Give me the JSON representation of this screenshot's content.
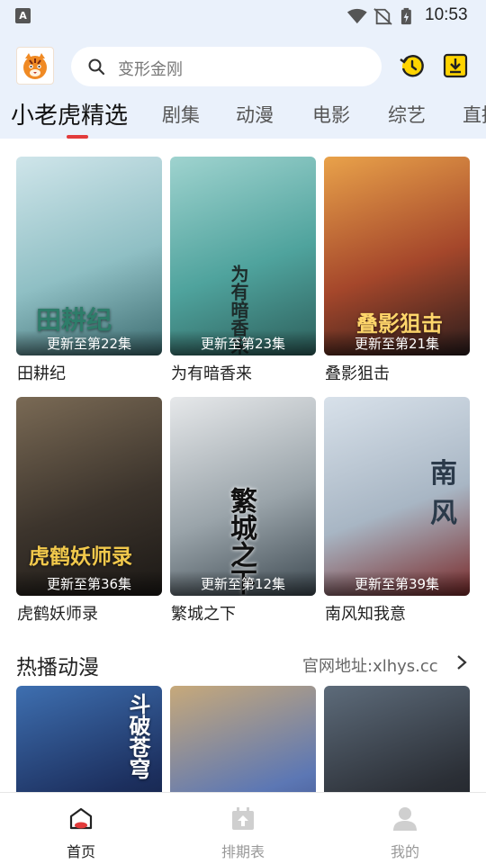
{
  "status_bar": {
    "notification_badge": "A",
    "time": "10:53",
    "icons": [
      "wifi-icon",
      "no-sim-icon",
      "battery-charging-icon"
    ]
  },
  "header": {
    "logo": "tiger-logo",
    "search_placeholder": "变形金刚",
    "icons": [
      "history-icon",
      "download-icon"
    ]
  },
  "tabs": [
    {
      "label": "小老虎精选",
      "active": true
    },
    {
      "label": "剧集",
      "active": false
    },
    {
      "label": "动漫",
      "active": false
    },
    {
      "label": "电影",
      "active": false
    },
    {
      "label": "综艺",
      "active": false
    },
    {
      "label": "直播",
      "active": false
    }
  ],
  "hot_dramas": {
    "items": [
      {
        "title": "田耕纪",
        "update": "更新至第22集",
        "art": "田耕纪",
        "colors": [
          "#cfe5ea",
          "#8fbfc4",
          "#3b6b6f"
        ]
      },
      {
        "title": "为有暗香来",
        "update": "更新至第23集",
        "art": "为有暗香来",
        "colors": [
          "#9fd3cf",
          "#4fa39d",
          "#2d5f5b"
        ]
      },
      {
        "title": "叠影狙击",
        "update": "更新至第21集",
        "art": "叠影狙击",
        "colors": [
          "#e9a24a",
          "#a5472b",
          "#2a1c1c"
        ]
      },
      {
        "title": "虎鹤妖师录",
        "update": "更新至第36集",
        "art": "虎鹤妖师录",
        "colors": [
          "#7a6a55",
          "#3c342c",
          "#1b1815"
        ]
      },
      {
        "title": "繁城之下",
        "update": "更新至第12集",
        "art": "繁城之下",
        "colors": [
          "#e6e8ea",
          "#9aa4aa",
          "#3e4a52"
        ]
      },
      {
        "title": "南风知我意",
        "update": "更新至第39集",
        "art": "南风",
        "colors": [
          "#d8e1ea",
          "#a8b6c4",
          "#7a2a2a"
        ]
      }
    ]
  },
  "hot_anime": {
    "title": "热播动漫",
    "link": "官网地址:xlhys.cc",
    "items": [
      {
        "art": "斗破苍穹",
        "colors": [
          "#3e6fb0",
          "#1c2f5e",
          "#0a1024"
        ]
      },
      {
        "art": "",
        "colors": [
          "#c7a97a",
          "#5c77b4",
          "#2a3266"
        ]
      },
      {
        "art": "",
        "colors": [
          "#5d6b7a",
          "#2b2f36",
          "#101216"
        ]
      }
    ]
  },
  "bottom_nav": [
    {
      "label": "首页",
      "icon": "home-icon",
      "active": true
    },
    {
      "label": "排期表",
      "icon": "calendar-icon",
      "active": false
    },
    {
      "label": "我的",
      "icon": "profile-icon",
      "active": false
    }
  ]
}
